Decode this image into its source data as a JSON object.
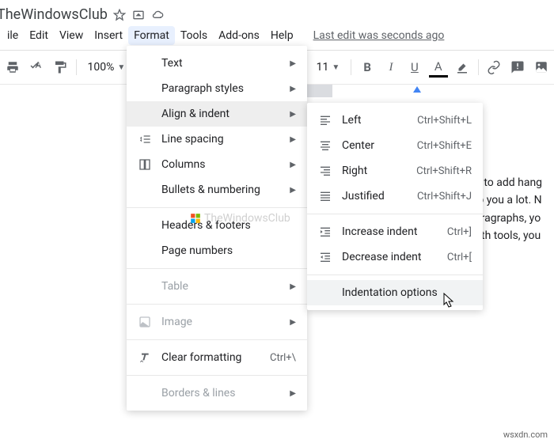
{
  "title": "TheWindowsClub",
  "menus": {
    "file": "ile",
    "edit": "Edit",
    "view": "View",
    "insert": "Insert",
    "format": "Format",
    "tools": "Tools",
    "addons": "Add-ons",
    "help": "Help"
  },
  "last_edit": "Last edit was seconds ago",
  "toolbar": {
    "zoom": "100%",
    "font_size": "11"
  },
  "format_menu": {
    "text": "Text",
    "paragraph": "Paragraph styles",
    "align": "Align & indent",
    "line_spacing": "Line spacing",
    "columns": "Columns",
    "bullets": "Bullets & numbering",
    "headers": "Headers & footers",
    "page_numbers": "Page numbers",
    "table": "Table",
    "image": "Image",
    "clear_formatting": "Clear formatting",
    "clear_shortcut": "Ctrl+\\",
    "borders": "Borders & lines"
  },
  "align_menu": {
    "left": "Left",
    "left_sc": "Ctrl+Shift+L",
    "center": "Center",
    "center_sc": "Ctrl+Shift+E",
    "right": "Right",
    "right_sc": "Ctrl+Shift+R",
    "justified": "Justified",
    "justified_sc": "Ctrl+Shift+J",
    "increase": "Increase indent",
    "increase_sc": "Ctrl+]",
    "decrease": "Decrease indent",
    "decrease_sc": "Ctrl+[",
    "options": "Indentation options"
  },
  "doc_text": {
    "l1": "g to add hang",
    "l2": "lp you a lot. N",
    "l3": "aragraphs, yo",
    "l4": "oth tools, you"
  },
  "watermark": "TheWindowsClub",
  "credit": "wsxdn.com"
}
